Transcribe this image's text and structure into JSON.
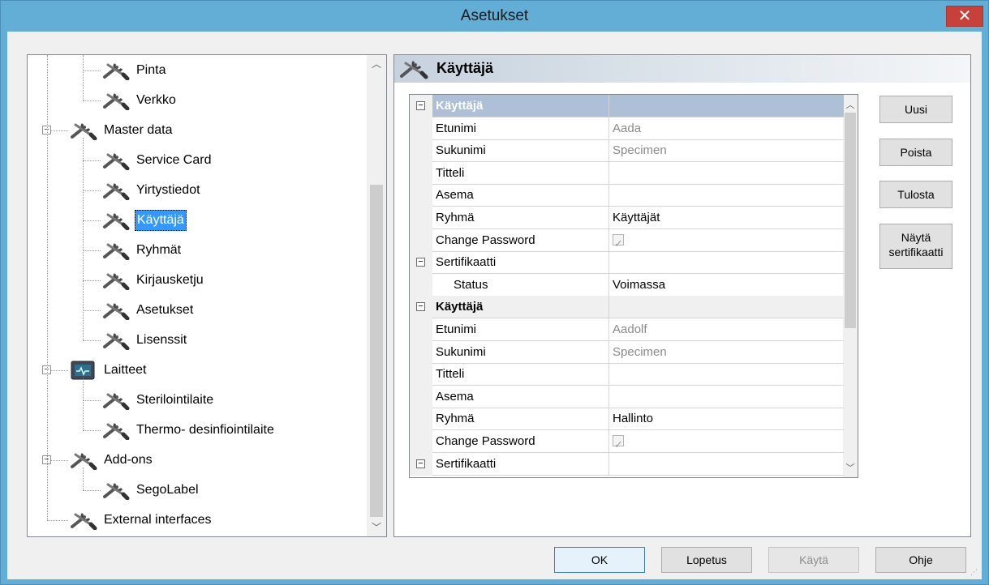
{
  "window": {
    "title": "Asetukset",
    "close_glyph": "✕"
  },
  "tree": {
    "items": [
      {
        "id": "pinta",
        "label": "Pinta",
        "icon": "tools-icon",
        "level": 2
      },
      {
        "id": "verkko",
        "label": "Verkko",
        "icon": "tools-icon",
        "level": 2
      },
      {
        "id": "master-data",
        "label": "Master data",
        "icon": "tools-icon",
        "level": 1,
        "expanded": true
      },
      {
        "id": "service-card",
        "label": "Service Card",
        "icon": "tools-icon",
        "level": 2
      },
      {
        "id": "yirtystiedot",
        "label": "Yirtystiedot",
        "icon": "tools-icon",
        "level": 2
      },
      {
        "id": "kayttaja",
        "label": "Käyttäjä",
        "icon": "tools-icon",
        "level": 2,
        "selected": true
      },
      {
        "id": "ryhmat",
        "label": "Ryhmät",
        "icon": "tools-icon",
        "level": 2
      },
      {
        "id": "kirjausketju",
        "label": "Kirjausketju",
        "icon": "tools-icon",
        "level": 2
      },
      {
        "id": "asetukset",
        "label": "Asetukset",
        "icon": "tools-icon",
        "level": 2
      },
      {
        "id": "lisenssit",
        "label": "Lisenssit",
        "icon": "tools-icon",
        "level": 2
      },
      {
        "id": "laitteet",
        "label": "Laitteet",
        "icon": "monitor-icon",
        "level": 1,
        "expanded": true
      },
      {
        "id": "sterilointilaite",
        "label": "Sterilointilaite",
        "icon": "tools-icon",
        "level": 2
      },
      {
        "id": "thermo",
        "label": "Thermo- desinfiointilaite",
        "icon": "tools-icon",
        "level": 2
      },
      {
        "id": "add-ons",
        "label": "Add-ons",
        "icon": "tools-icon",
        "level": 1,
        "expanded": true
      },
      {
        "id": "segolabel",
        "label": "SegoLabel",
        "icon": "tools-icon",
        "level": 2
      },
      {
        "id": "external",
        "label": "External interfaces",
        "icon": "tools-icon",
        "level": 1
      }
    ]
  },
  "panel": {
    "title": "Käyttäjä",
    "icon": "tools-icon"
  },
  "grid": {
    "rows": [
      {
        "type": "category",
        "name": "Käyttäjä",
        "selected": true
      },
      {
        "type": "prop",
        "name": "Etunimi",
        "value": "Aada",
        "gray": true
      },
      {
        "type": "prop",
        "name": "Sukunimi",
        "value": "Specimen",
        "gray": true
      },
      {
        "type": "prop",
        "name": "Titteli",
        "value": ""
      },
      {
        "type": "prop",
        "name": "Asema",
        "value": ""
      },
      {
        "type": "prop",
        "name": "Ryhmä",
        "value": "Käyttäjät"
      },
      {
        "type": "prop",
        "name": "Change Password",
        "value": "",
        "checkbox": true
      },
      {
        "type": "subcategory",
        "name": "Sertifikaatti"
      },
      {
        "type": "prop",
        "name": "Status",
        "value": "Voimassa",
        "indent": true
      },
      {
        "type": "category",
        "name": "Käyttäjä",
        "selected": false
      },
      {
        "type": "prop",
        "name": "Etunimi",
        "value": "Aadolf",
        "gray": true
      },
      {
        "type": "prop",
        "name": "Sukunimi",
        "value": "Specimen",
        "gray": true
      },
      {
        "type": "prop",
        "name": "Titteli",
        "value": ""
      },
      {
        "type": "prop",
        "name": "Asema",
        "value": ""
      },
      {
        "type": "prop",
        "name": "Ryhmä",
        "value": "Hallinto"
      },
      {
        "type": "prop",
        "name": "Change Password",
        "value": "",
        "checkbox": true
      },
      {
        "type": "subcategory",
        "name": "Sertifikaatti"
      }
    ]
  },
  "side_buttons": {
    "new": "Uusi",
    "delete": "Poista",
    "print": "Tulosta",
    "show_cert_line1": "Näytä",
    "show_cert_line2": "sertifikaatti"
  },
  "footer": {
    "ok": "OK",
    "cancel": "Lopetus",
    "apply": "Käytä",
    "help": "Ohje"
  }
}
